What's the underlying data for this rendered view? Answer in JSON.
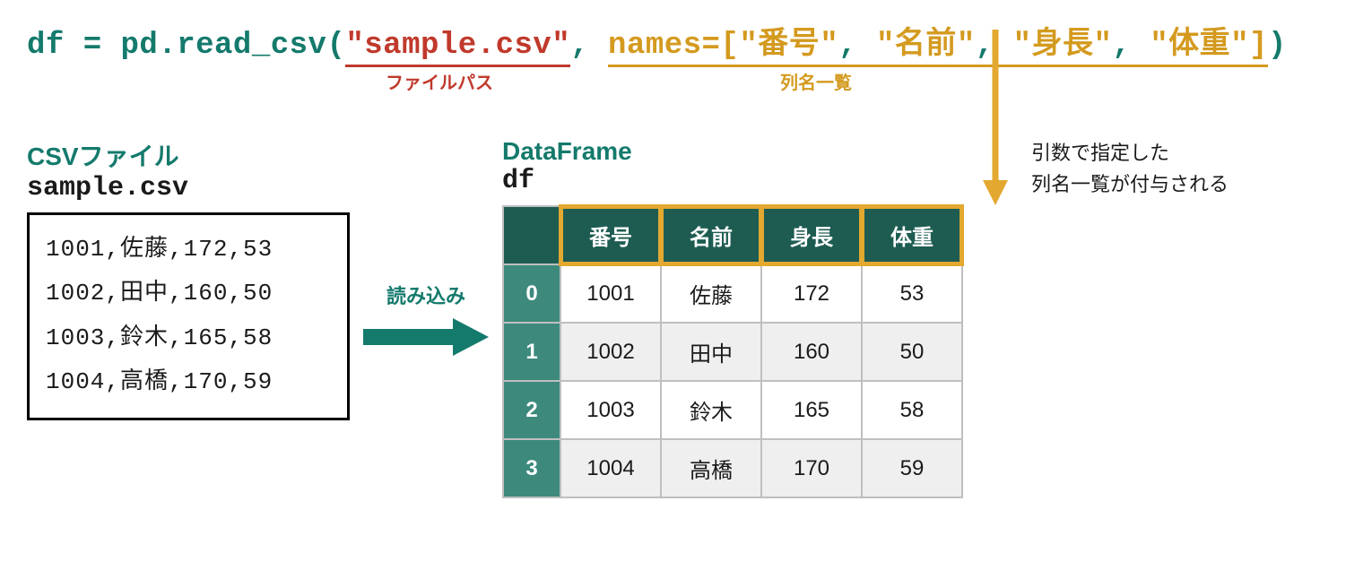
{
  "code": {
    "prefix": "df = pd.read_csv(",
    "file_arg": "\"sample.csv\"",
    "comma": ", ",
    "names_key": "names=[",
    "col1": "\"番号\"",
    "col2": "\"名前\"",
    "col3": "\"身長\"",
    "col4": "\"体重\"",
    "names_close": "]",
    "paren_close": ")"
  },
  "anno": {
    "file": "ファイルパス",
    "cols": "列名一覧",
    "read": "読み込み",
    "callout1": "引数で指定した",
    "callout2": "列名一覧が付与される"
  },
  "csv": {
    "title": "CSVファイル",
    "filename": "sample.csv",
    "lines": [
      "1001,佐藤,172,53",
      "1002,田中,160,50",
      "1003,鈴木,165,58",
      "1004,高橋,170,59"
    ]
  },
  "df": {
    "title": "DataFrame",
    "var": "df",
    "headers": [
      "番号",
      "名前",
      "身長",
      "体重"
    ],
    "index": [
      "0",
      "1",
      "2",
      "3"
    ],
    "rows": [
      [
        "1001",
        "佐藤",
        "172",
        "53"
      ],
      [
        "1002",
        "田中",
        "160",
        "50"
      ],
      [
        "1003",
        "鈴木",
        "165",
        "58"
      ],
      [
        "1004",
        "高橋",
        "170",
        "59"
      ]
    ]
  },
  "chart_data": {
    "type": "table",
    "title": "DataFrame df",
    "columns": [
      "番号",
      "名前",
      "身長",
      "体重"
    ],
    "index": [
      0,
      1,
      2,
      3
    ],
    "data": [
      [
        1001,
        "佐藤",
        172,
        53
      ],
      [
        1002,
        "田中",
        160,
        50
      ],
      [
        1003,
        "鈴木",
        165,
        58
      ],
      [
        1004,
        "高橋",
        170,
        59
      ]
    ],
    "source_csv": {
      "filename": "sample.csv",
      "raw_lines": [
        "1001,佐藤,172,53",
        "1002,田中,160,50",
        "1003,鈴木,165,58",
        "1004,高橋,170,59"
      ]
    },
    "code": "df = pd.read_csv(\"sample.csv\", names=[\"番号\", \"名前\", \"身長\", \"体重\"])"
  }
}
